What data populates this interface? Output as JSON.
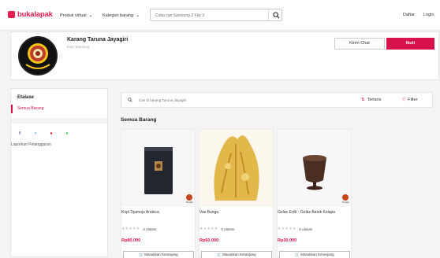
{
  "header": {
    "logo_text": "bukalapak",
    "menu_produk_virtual": "Produk virtual",
    "menu_kategori": "Kategori barang",
    "search_placeholder": "Coba cari Samsung Z Flip 3",
    "daftar": "Daftar",
    "login": "Login"
  },
  "store": {
    "name": "Karang Taruna Jayagiri",
    "location": "Kab. Bandung",
    "chat_label": "Kirim Chat",
    "follow_label": "Ikuti"
  },
  "sidebar": {
    "title": "Etalase",
    "items": [
      {
        "label": "Semua Barang",
        "active": true
      }
    ],
    "social": [
      {
        "icon": "facebook-icon",
        "glyph": "f",
        "color": "#3b5998"
      },
      {
        "icon": "twitter-icon",
        "glyph": "•",
        "color": "#1da1f2"
      },
      {
        "icon": "pinterest-icon",
        "glyph": "●",
        "color": "#e60023"
      },
      {
        "icon": "line-icon",
        "glyph": "●",
        "color": "#2ecc40"
      }
    ],
    "report_label": "Laporkan Pelanggaran"
  },
  "products_filter": {
    "search_placeholder": "Cari di barang Taruna Jayagiri",
    "sort_label": "Terlaris",
    "filter_label": "Filter"
  },
  "section_title": "Semua Barang",
  "products": [
    {
      "name": "Kopi Djamoju Arabica",
      "stars": "★★★★★",
      "reviews": "0 ulasan",
      "price": "Rp80.000",
      "buy_label": "Masukkan Keranjang",
      "badge": "Pendo"
    },
    {
      "name": "Vas Bunga",
      "stars": "★★★★★",
      "reviews": "0 ulasan",
      "price": "Rp60.000",
      "buy_label": "Masukkan Keranjang",
      "badge": ""
    },
    {
      "name": "Gelas Ertik - Gelas Batok Kelapa",
      "stars": "★★★★★",
      "reviews": "0 ulasan",
      "price": "Rp30.000",
      "buy_label": "Masukkan Keranjang",
      "badge": "Pendo"
    }
  ],
  "colors": {
    "brand": "#e31e52",
    "accent": "#d71149"
  }
}
